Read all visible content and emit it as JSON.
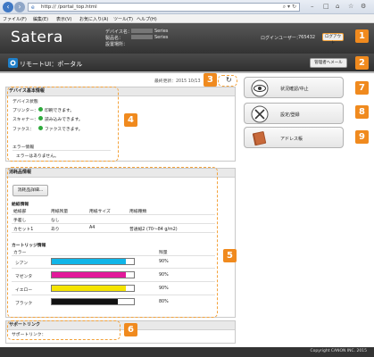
{
  "browser": {
    "url": "http://            /portal_top.html",
    "menu": [
      "ファイル(F)",
      "編集(E)",
      "表示(V)",
      "お気に入り(A)",
      "ツール(T)",
      "ヘルプ(H)"
    ]
  },
  "header": {
    "logo": "Satera",
    "device_name_label": "デバイス名：",
    "product_name_label": "製品名：",
    "location_label": "設置場所：",
    "device_name_value": "Series",
    "product_name_value": "Series",
    "login_user_label": "ログインユーザー：",
    "login_user_value": "765432",
    "logout_label": "ログアウト",
    "mail_to_admin": "管理者へメール"
  },
  "page": {
    "title": "リモートUI：ポータル",
    "last_updated": "最終更新：2015 10/13"
  },
  "device_info": {
    "heading": "デバイス基本情報",
    "status_heading": "デバイス状態",
    "status_rows": [
      {
        "label": "プリンター：",
        "value": "印刷できます。"
      },
      {
        "label": "スキャナー：",
        "value": "読み込みできます。"
      },
      {
        "label": "ファクス：",
        "value": "ファクスできます。"
      }
    ],
    "error_heading": "エラー情報",
    "error_text": "エラーはありません。"
  },
  "consumables": {
    "heading": "消耗品情報",
    "check_button": "消耗品詳細...",
    "paper_heading": "給紙情報",
    "paper_headers": [
      "給紙部",
      "用紙残量",
      "用紙サイズ",
      "用紙種類"
    ],
    "paper_rows": [
      [
        "手差し",
        "なし",
        "",
        ""
      ],
      [
        "カセット1",
        "あり",
        "A4",
        "普通紙2 (70～84 g/m2)"
      ]
    ],
    "cartridge_heading": "カートリッジ情報",
    "cartridge_headers": [
      "カラー",
      "",
      "残量"
    ],
    "cartridges": [
      {
        "name": "シアン",
        "level": "90%",
        "fill": 0.9,
        "color": "#10b5e8"
      },
      {
        "name": "マゼンタ",
        "level": "90%",
        "fill": 0.9,
        "color": "#e2189a"
      },
      {
        "name": "イエロー",
        "level": "90%",
        "fill": 0.9,
        "color": "#f5e400"
      },
      {
        "name": "ブラック",
        "level": "80%",
        "fill": 0.8,
        "color": "#111111"
      }
    ]
  },
  "support": {
    "heading": "サポートリンク",
    "link_label": "サポートリンク："
  },
  "right_menu": [
    {
      "label": "状況確認/中止",
      "icon": "eye-icon"
    },
    {
      "label": "設定/登録",
      "icon": "wrench-screwdriver-icon"
    },
    {
      "label": "アドレス帳",
      "icon": "address-book-icon"
    }
  ],
  "markers": [
    "1",
    "2",
    "3",
    "4",
    "5",
    "6",
    "7",
    "8",
    "9"
  ],
  "footer": {
    "copyright": "Copyright CANON INC. 2015"
  }
}
